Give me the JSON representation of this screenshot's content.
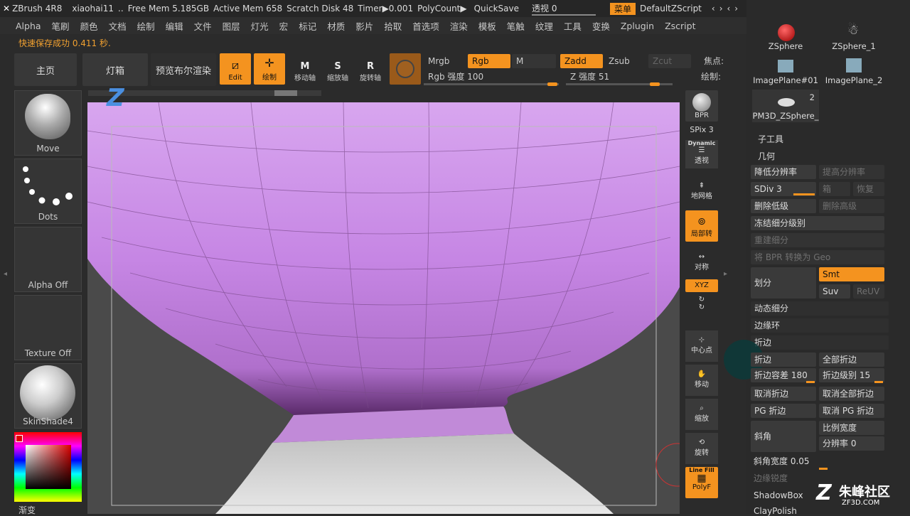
{
  "titlebar": {
    "app": "ZBrush 4R8",
    "user": "xiaohai11",
    "free_mem": "Free Mem 5.185GB",
    "active_mem": "Active Mem 658",
    "scratch": "Scratch Disk 48",
    "timer": "Timer▶0.001",
    "polycount": "PolyCount▶",
    "quicksave": "QuickSave",
    "perspective": "透视 0",
    "menu": "菜单",
    "script": "DefaultZScript"
  },
  "menus": [
    "Alpha",
    "笔刷",
    "颜色",
    "文档",
    "绘制",
    "编辑",
    "文件",
    "图层",
    "灯光",
    "宏",
    "标记",
    "材质",
    "影片",
    "拾取",
    "首选项",
    "渲染",
    "模板",
    "笔触",
    "纹理",
    "工具",
    "变换",
    "Zplugin",
    "Zscript"
  ],
  "status": "快速保存成功 0.411 秒.",
  "toolbar": {
    "home": "主页",
    "light": "灯箱",
    "bpr": "预览布尔渲染",
    "edit": "Edit",
    "draw": "绘制",
    "move": "移动轴",
    "scale": "缩放轴",
    "rotate": "旋转轴",
    "mrgb": "Mrgb",
    "rgb": "Rgb",
    "m": "M",
    "zadd": "Zadd",
    "zsub": "Zsub",
    "zcut": "Zcut",
    "rgb_intensity": "Rgb 强度 100",
    "z_intensity": "Z 强度 51",
    "focal": "焦点:",
    "draw_size": "绘制:"
  },
  "left": {
    "move": "Move",
    "dots": "Dots",
    "alpha": "Alpha Off",
    "texture": "Texture Off",
    "material": "SkinShade4",
    "gradient": "渐变"
  },
  "rstrip": {
    "bpr": "BPR",
    "spix": "SPix 3",
    "dynamic": "Dynamic",
    "persp": "透视",
    "floor": "地网格",
    "local": "局部转",
    "sym": "对称",
    "xyz": "XYZ",
    "center": "中心点",
    "move": "移动",
    "zoom": "缩放",
    "rotate": "旋转",
    "linefill": "Line Fill",
    "polyf": "PolyF"
  },
  "subtools": [
    {
      "name": "ZSphere"
    },
    {
      "name": "ZSphere_1"
    },
    {
      "name": "ImagePlane#01"
    },
    {
      "name": "ImagePlane_2"
    },
    {
      "name": "PM3D_ZSphere_",
      "count": "2"
    }
  ],
  "geom": {
    "subtool": "子工具",
    "geometry": "几何",
    "lower": "降低分辨率",
    "higher": "提高分辨率",
    "sdiv": "SDiv 3",
    "cage": "箱",
    "restore": "恢复",
    "dellower": "删除低级",
    "delhigher": "删除高级",
    "freeze": "冻结细分级别",
    "reconstruct": "重建细分",
    "bpr2geo": "将 BPR 转换为 Geo",
    "divide": "划分",
    "smt": "Smt",
    "suv": "Suv",
    "reuv": "ReUV",
    "dynsub": "动态细分",
    "edgeloop": "边缘环",
    "crease": "折边",
    "crease_btn": "折边",
    "crease_all": "全部折边",
    "crease_tol": "折边容差 180",
    "crease_lvl": "折边级别 15",
    "uncrease": "取消折边",
    "uncrease_all": "取消全部折边",
    "pgcrease": "PG 折边",
    "uncrease_pg": "取消 PG 折边",
    "bevel": "斜角",
    "bevel_ratio": "比例宽度",
    "bevel_res": "分辨率 0",
    "bevel_width": "斜角宽度 0.05",
    "edge_sharp": "边缘锐度",
    "shadowbox": "ShadowBox",
    "claypolish": "ClayPolish"
  },
  "watermark": {
    "brand": "朱峰社区",
    "url": "ZF3D.COM"
  }
}
